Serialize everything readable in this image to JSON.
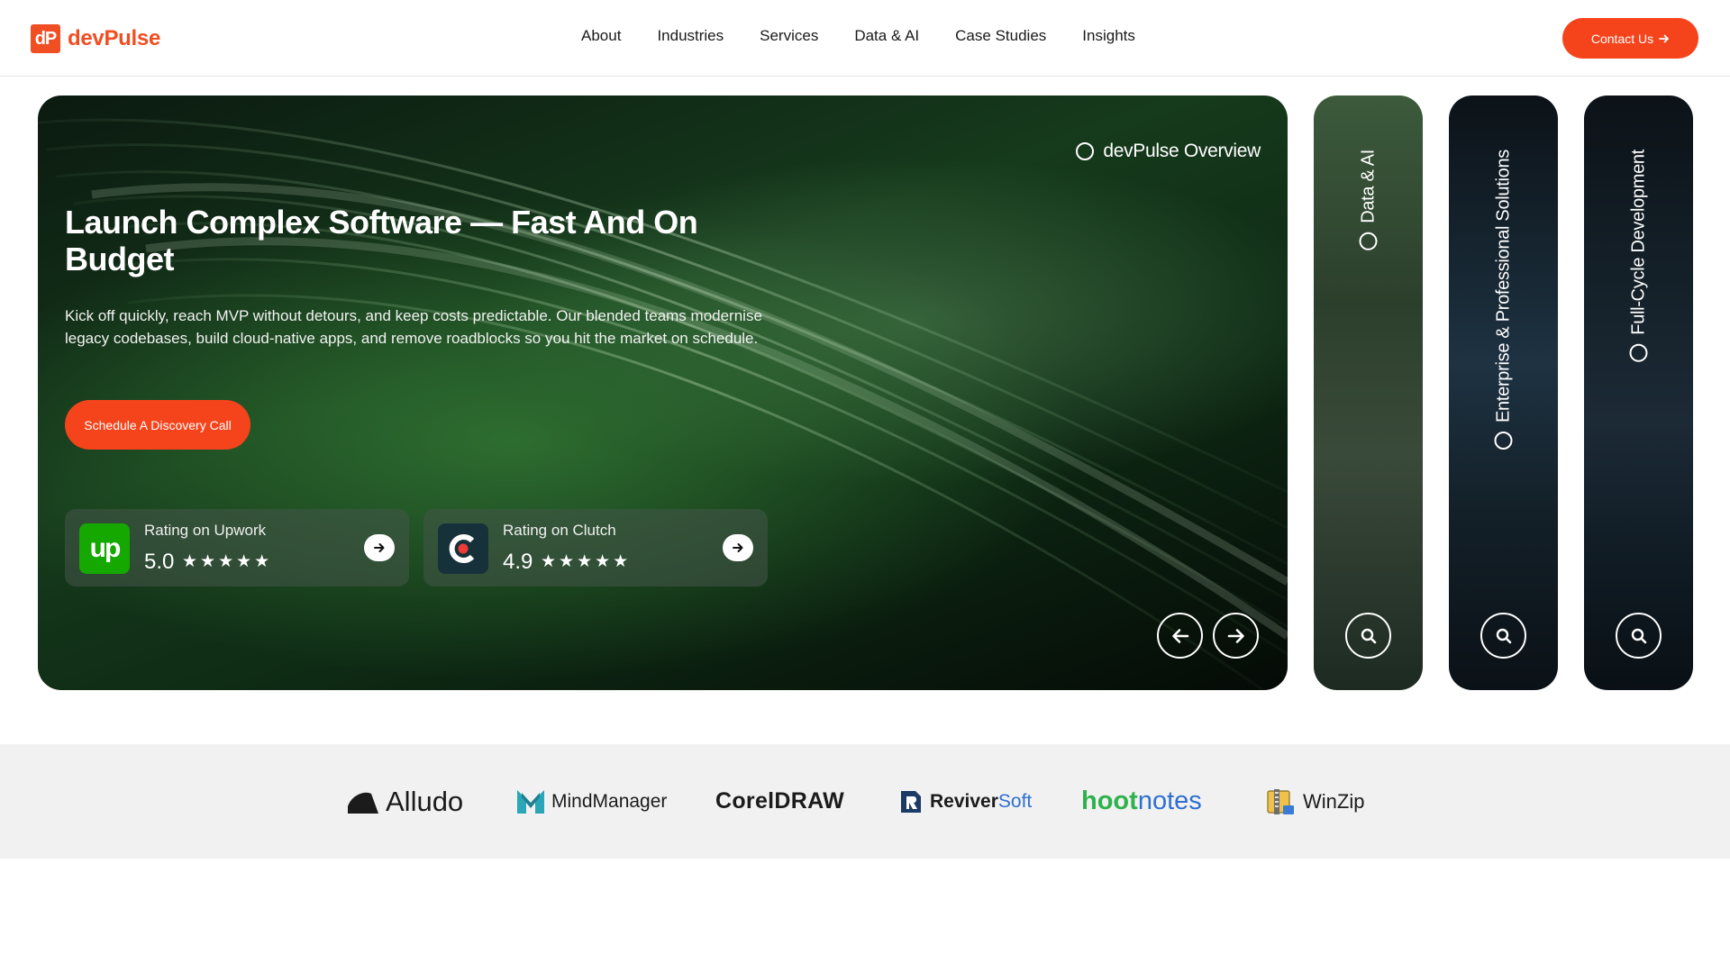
{
  "header": {
    "logo_mark": "dP",
    "logo_text": "devPulse",
    "nav": [
      "About",
      "Industries",
      "Services",
      "Data & AI",
      "Case Studies",
      "Insights"
    ],
    "contact_label": "Contact Us"
  },
  "hero": {
    "overview_label": "devPulse Overview",
    "title": "Launch Complex Software — Fast And On Budget",
    "description": "Kick off quickly, reach MVP without detours, and keep costs predictable. Our blended teams modernise legacy codebases, build cloud-native apps, and remove roadblocks so you hit the market on schedule.",
    "cta_label": "Schedule A Discovery Call",
    "ratings": [
      {
        "label": "Rating on Upwork",
        "score": "5.0",
        "stars": 5,
        "logo": "upwork-logo",
        "logo_text": "up"
      },
      {
        "label": "Rating on Clutch",
        "score": "4.9",
        "stars": 5,
        "logo": "clutch-logo"
      }
    ]
  },
  "panels": [
    {
      "label": "Data & AI"
    },
    {
      "label": "Enterprise & Professional Solutions"
    },
    {
      "label": "Full-Cycle Development"
    }
  ],
  "clients": {
    "alludo": "Alludo",
    "mindmanager": "MindManager",
    "coreldraw": "CorelDRAW",
    "reviver_a": "Reviver",
    "reviver_b": "Soft",
    "hoot_a": "hoot",
    "hoot_b": "notes",
    "winzip": "WinZip"
  },
  "colors": {
    "accent": "#f5441c",
    "logo": "#f04e23",
    "upwork": "#14a800",
    "hoot_green": "#2fb24c",
    "reviver_blue": "#2f6fd0"
  }
}
